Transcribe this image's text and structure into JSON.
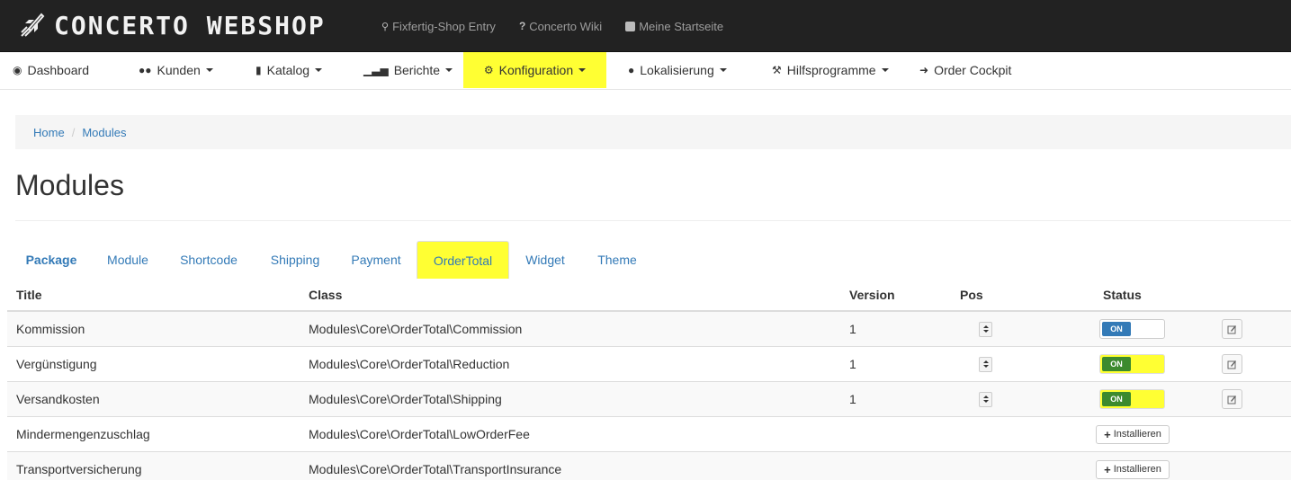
{
  "brand": {
    "name": "CONCERTO WEBSHOP"
  },
  "toplinks": [
    {
      "label": "Fixfertig-Shop Entry",
      "icon": "key-icon"
    },
    {
      "label": "Concerto Wiki",
      "icon": "question-icon"
    },
    {
      "label": "Meine Startseite",
      "icon": "external-link-icon"
    }
  ],
  "nav": [
    {
      "label": "Dashboard",
      "icon": "dashboard-icon",
      "dropdown": false
    },
    {
      "label": "Kunden",
      "icon": "users-icon",
      "dropdown": true
    },
    {
      "label": "Katalog",
      "icon": "book-icon",
      "dropdown": true
    },
    {
      "label": "Berichte",
      "icon": "chart-icon",
      "dropdown": true
    },
    {
      "label": "Konfiguration",
      "icon": "cogs-icon",
      "dropdown": true,
      "highlighted": true
    },
    {
      "label": "Lokalisierung",
      "icon": "globe-icon",
      "dropdown": true
    },
    {
      "label": "Hilfsprogramme",
      "icon": "wrench-icon",
      "dropdown": true
    },
    {
      "label": "Order Cockpit",
      "icon": "sign-in-icon",
      "dropdown": false
    }
  ],
  "breadcrumb": {
    "home": "Home",
    "separator": "/",
    "current": "Modules"
  },
  "page_title": "Modules",
  "tabs": [
    "Package",
    "Module",
    "Shortcode",
    "Shipping",
    "Payment",
    "OrderTotal",
    "Widget",
    "Theme"
  ],
  "active_tab": "Package",
  "highlighted_tab": "OrderTotal",
  "table": {
    "headers": {
      "title": "Title",
      "class": "Class",
      "version": "Version",
      "pos": "Pos",
      "status": "Status"
    },
    "rows": [
      {
        "title": "Kommission",
        "class": "Modules\\Core\\OrderTotal\\Commission",
        "version": "1",
        "status": "ON"
      },
      {
        "title": "Vergünstigung",
        "class": "Modules\\Core\\OrderTotal\\Reduction",
        "version": "1",
        "status": "ON"
      },
      {
        "title": "Versandkosten",
        "class": "Modules\\Core\\OrderTotal\\Shipping",
        "version": "1",
        "status": "ON"
      },
      {
        "title": "Mindermengenzuschlag",
        "class": "Modules\\Core\\OrderTotal\\LowOrderFee",
        "install_label": "Installieren"
      },
      {
        "title": "Transportversicherung",
        "class": "Modules\\Core\\OrderTotal\\TransportInsurance",
        "install_label": "Installieren"
      }
    ]
  },
  "colors": {
    "highlight": "#ffff33",
    "link": "#337ab7",
    "toggle_on": "#337ab7",
    "toggle_on_highlighted": "#3c8a2e",
    "topbar": "#222222"
  }
}
